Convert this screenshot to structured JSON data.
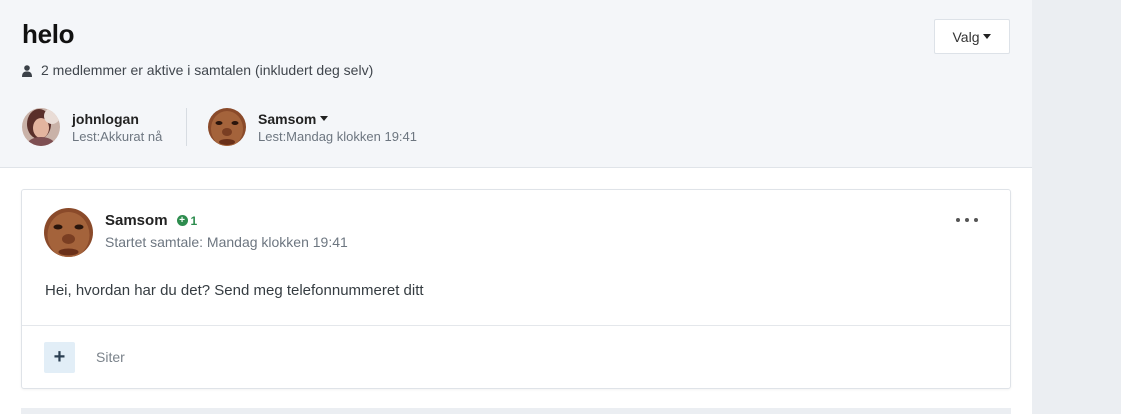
{
  "conversation": {
    "title": "helo",
    "members_text": "2 medlemmer er aktive i samtalen (inkludert deg selv)",
    "options_label": "Valg"
  },
  "participants": [
    {
      "name": "johnlogan",
      "status": "Lest:Akkurat nå"
    },
    {
      "name": "Samsom",
      "status": "Lest:Mandag klokken 19:41"
    }
  ],
  "post": {
    "author": "Samsom",
    "reputation": "1",
    "started": "Startet samtale: Mandag klokken 19:41",
    "body": "Hei, hvordan har du det? Send meg telefonnummeret ditt",
    "cite_icon": "+",
    "cite_label": "Siter"
  },
  "colors": {
    "header_bg": "#f4f6f9",
    "rail_bg": "#ebeef2",
    "reputation_green": "#2d8c4e",
    "cite_button_bg": "#e2eef7"
  }
}
